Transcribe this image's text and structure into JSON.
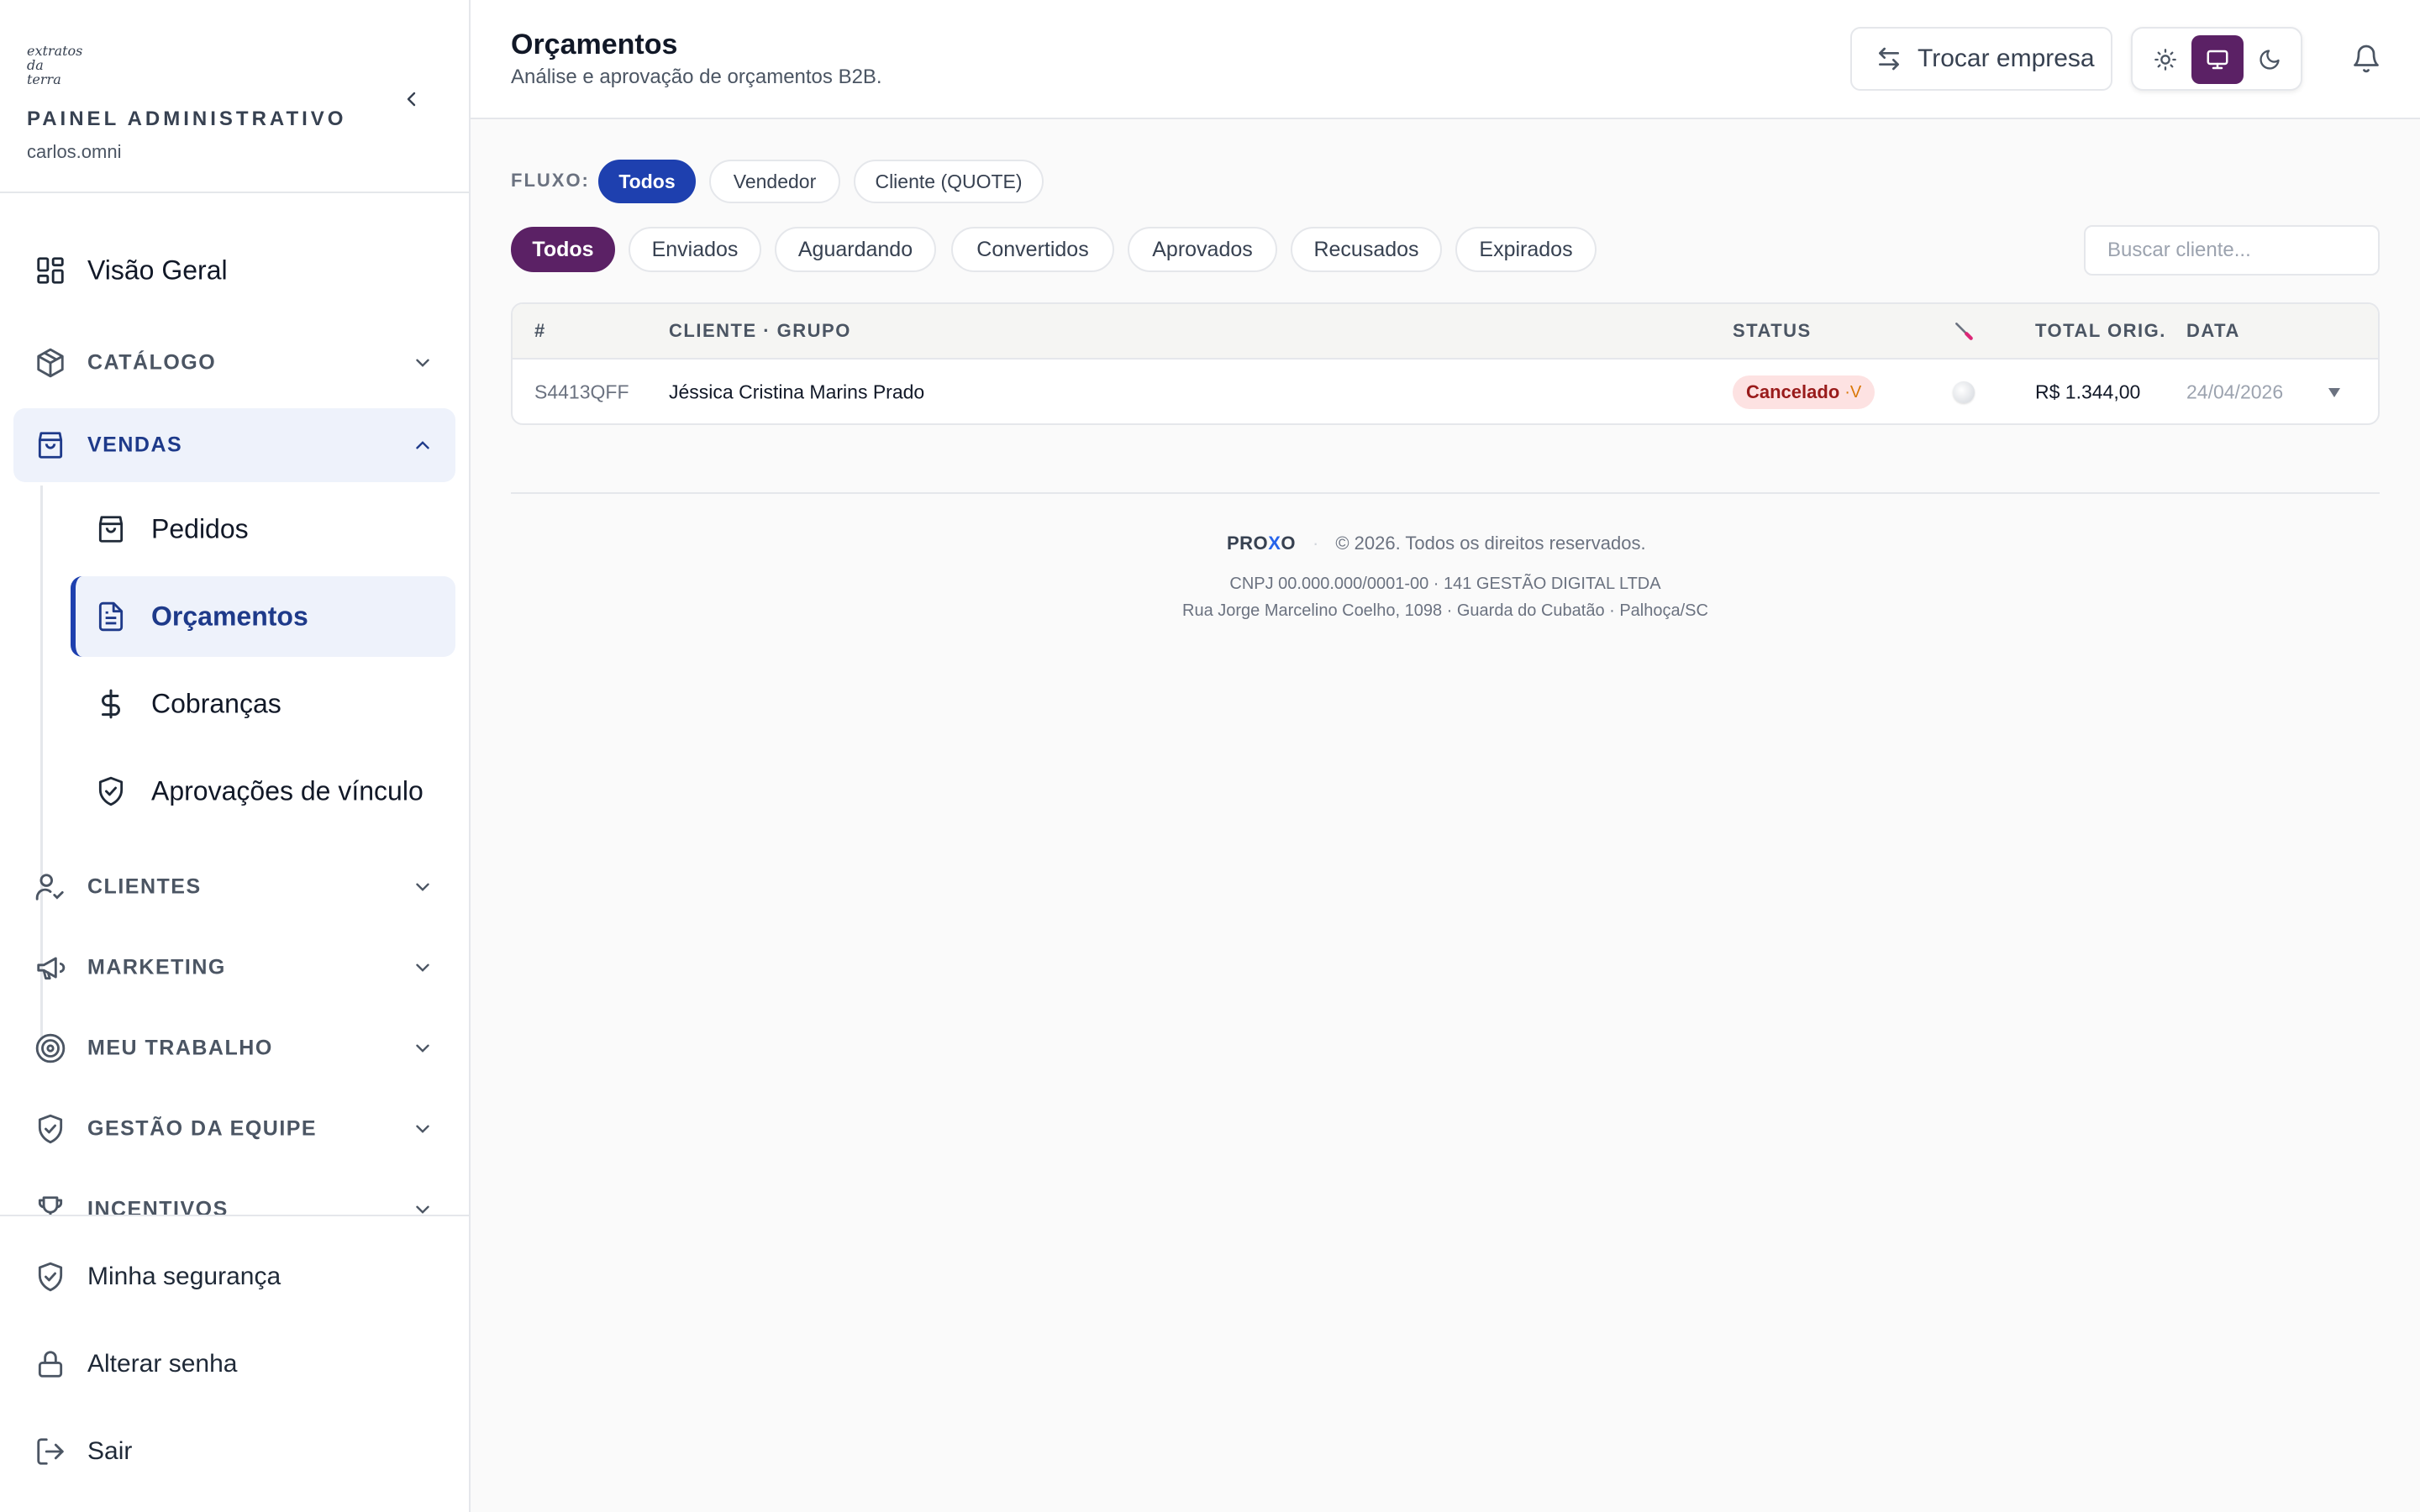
{
  "sidebar": {
    "brand": "extratos da terra",
    "panel_title": "PAINEL ADMINISTRATIVO",
    "user": "carlos.omni",
    "overview": "Visão Geral",
    "sections": {
      "catalog": "CATÁLOGO",
      "sales": "VENDAS",
      "clients": "CLIENTES",
      "marketing": "MARKETING",
      "my_work": "MEU TRABALHO",
      "team": "GESTÃO DA EQUIPE",
      "incentives": "INCENTIVOS"
    },
    "sales_items": {
      "orders": "Pedidos",
      "quotes": "Orçamentos",
      "charges": "Cobranças",
      "approvals": "Aprovações de vínculo"
    },
    "bottom": {
      "security": "Minha segurança",
      "password": "Alterar senha",
      "logout": "Sair"
    }
  },
  "header": {
    "title": "Orçamentos",
    "subtitle": "Análise e aprovação de orçamentos B2B.",
    "switch_company": "Trocar empresa"
  },
  "filters": {
    "flow_label": "FLUXO:",
    "flow": [
      "Todos",
      "Vendedor",
      "Cliente (QUOTE)"
    ],
    "status": [
      "Todos",
      "Enviados",
      "Aguardando",
      "Convertidos",
      "Aprovados",
      "Recusados",
      "Expirados"
    ],
    "search_placeholder": "Buscar cliente..."
  },
  "table": {
    "headers": {
      "id": "#",
      "client": "CLIENTE · GRUPO",
      "status": "STATUS",
      "total": "TOTAL ORIG.",
      "date": "DATA"
    },
    "rows": [
      {
        "id": "S4413QFF",
        "client": "Jéssica Cristina Marins Prado",
        "status": "Cancelado",
        "status_suffix": "·V",
        "total": "R$ 1.344,00",
        "date": "24/04/2026"
      }
    ]
  },
  "footer": {
    "logo_a": "PRO",
    "logo_b": "X",
    "logo_c": "O",
    "copyright": "© 2026. Todos os direitos reservados.",
    "cnpj": "CNPJ 00.000.000/0001-00 · 141 GESTÃO DIGITAL LTDA",
    "address": "Rua Jorge Marcelino Coelho, 1098 · Guarda do Cubatão · Palhoça/SC"
  },
  "colors": {
    "accent_blue": "#1e40af",
    "accent_purple": "#5b2165",
    "cancel_badge_bg": "#fde2e2"
  }
}
